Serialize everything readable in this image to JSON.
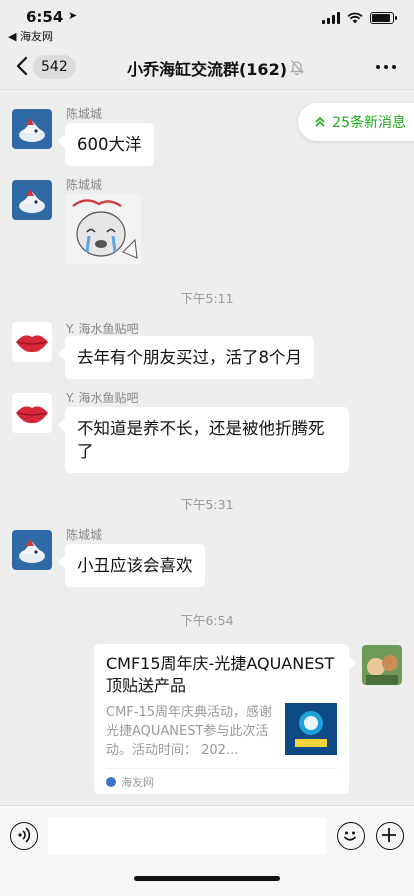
{
  "status": {
    "time": "6:54",
    "back_app": "◀ 海友网",
    "battery_level": 0.9
  },
  "nav": {
    "unread_count": "542",
    "title": "小乔海缸交流群(162)"
  },
  "new_messages": "25条新消息",
  "messages": [
    {
      "sender": "陈城城",
      "text": "600大洋"
    },
    {
      "sender": "陈城城",
      "sticker": "sticker-image"
    },
    {
      "time": "下午5:11"
    },
    {
      "sender": "Y. 海水鱼贴吧",
      "text": "去年有个朋友买过，活了8个月"
    },
    {
      "sender": "Y. 海水鱼贴吧",
      "text": "不知道是养不长，还是被他折腾死了"
    },
    {
      "time": "下午5:31"
    },
    {
      "sender": "陈城城",
      "text": "小丑应该会喜欢"
    },
    {
      "time": "下午6:54"
    }
  ],
  "card": {
    "title": "CMF15周年庆-光捷AQUANEST顶贴送产品",
    "description": "CMF-15周年庆典活动，感谢光捷AQUANEST参与此次活动。活动时间： 202...",
    "source": "海友网"
  },
  "colors": {
    "background": "#ededed",
    "bubble": "#ffffff",
    "accent": "#1aad19"
  }
}
